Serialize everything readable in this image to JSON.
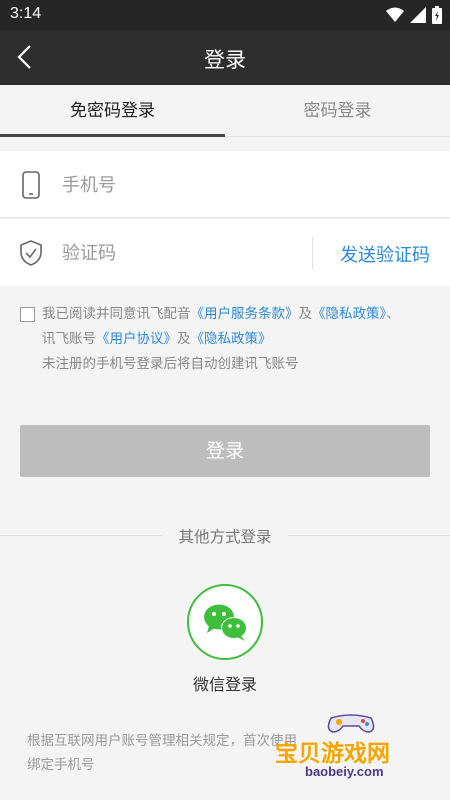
{
  "status_bar": {
    "time": "3:14"
  },
  "app_bar": {
    "title": "登录"
  },
  "tabs": [
    {
      "label": "免密码登录",
      "active": true
    },
    {
      "label": "密码登录",
      "active": false
    }
  ],
  "phone_field": {
    "placeholder": "手机号",
    "value": ""
  },
  "code_field": {
    "placeholder": "验证码",
    "value": "",
    "send_label": "发送验证码"
  },
  "agreement": {
    "line1_prefix": "我已阅读并同意讯飞配音",
    "link_service": "《用户服务条款》",
    "and1": "及",
    "link_privacy1": "《隐私政策》",
    "sep": "、",
    "line2_prefix": "讯飞账号",
    "link_user_agreement": "《用户协议》",
    "and2": "及",
    "link_privacy2": "《隐私政策》",
    "line3": "未注册的手机号登录后将自动创建讯飞账号",
    "checked": false
  },
  "login_button": {
    "label": "登录"
  },
  "other_login": {
    "label": "其他方式登录",
    "wechat_label": "微信登录"
  },
  "footer": {
    "note_line1": "根据互联网用户账号管理相关规定，首次使用",
    "note_line2": "绑定手机号"
  },
  "watermark": {
    "text": "宝贝游戏网",
    "url": "baobeiy.com"
  },
  "colors": {
    "accent": "#2d8ad8",
    "wechat": "#3fbe3c",
    "app_bar": "#2e2e2e",
    "disabled_button": "#bdbdbd"
  }
}
